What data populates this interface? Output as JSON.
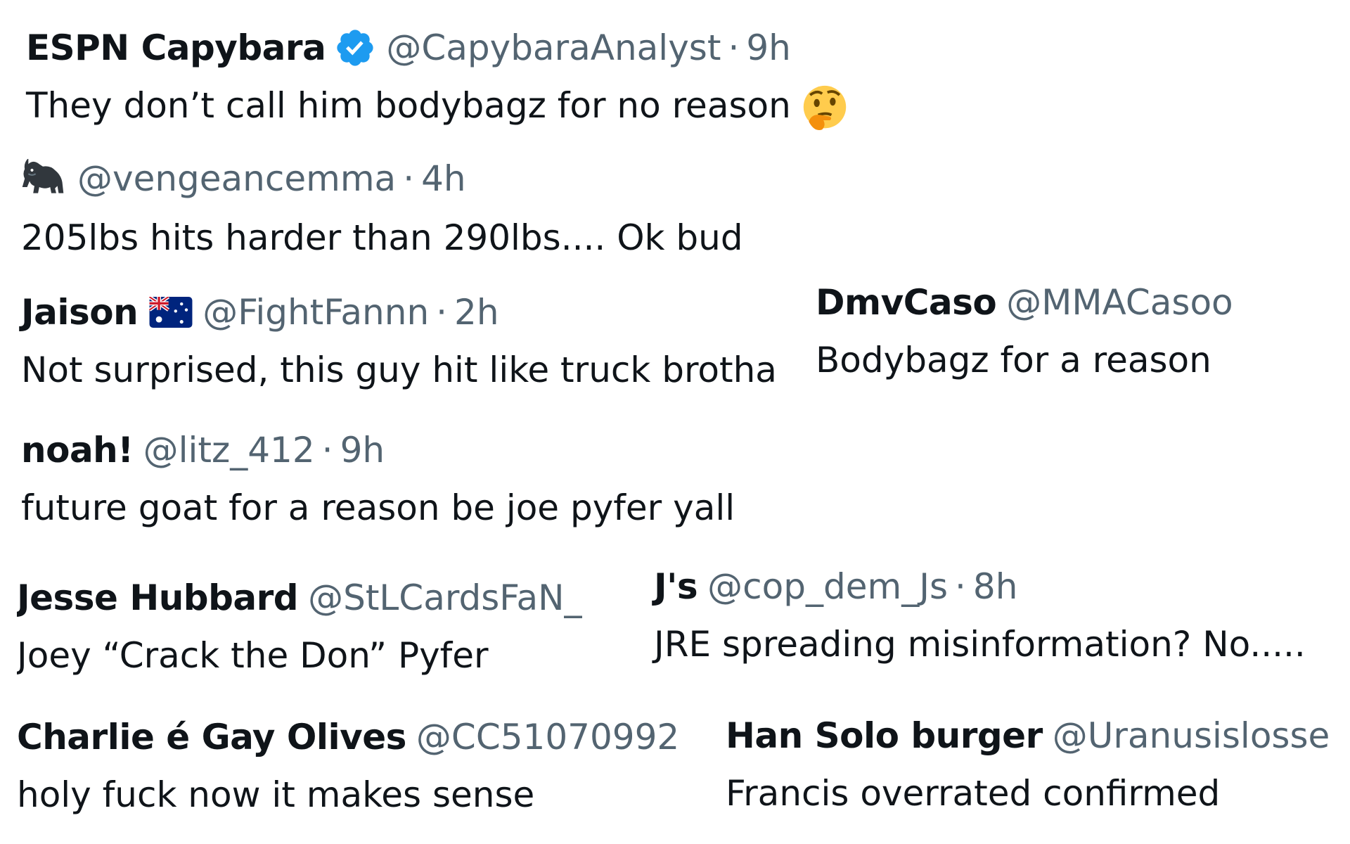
{
  "tweets": [
    {
      "name": "ESPN Capybara",
      "handle": "@CapybaraAnalyst",
      "sep": "·",
      "time": "9h",
      "text": "They don’t call him bodybagz for no reason",
      "text_emoji": "thinking-face-icon",
      "badge": "verified-badge-icon"
    },
    {
      "name_icon": "gorilla-icon",
      "handle": "@vengeancemma",
      "sep": "·",
      "time": "4h",
      "text": "205lbs hits harder than 290lbs.... Ok bud"
    },
    {
      "name": "Jaison",
      "flag": "australia-flag-icon",
      "handle": "@FightFannn",
      "sep": "·",
      "time": "2h",
      "text": "Not surprised, this guy hit like truck brotha"
    },
    {
      "name": "DmvCaso",
      "handle": "@MMACasoo",
      "text": "Bodybagz for a reason"
    },
    {
      "name": "noah!",
      "handle": "@litz_412",
      "sep": "·",
      "time": "9h",
      "text": "future goat for a reason be joe pyfer yall"
    },
    {
      "name": "Jesse Hubbard",
      "handle": "@StLCardsFaN_",
      "text": "Joey “Crack the Don” Pyfer"
    },
    {
      "name": "J's",
      "handle": "@cop_dem_Js",
      "sep": "·",
      "time": "8h",
      "text": "JRE spreading misinformation? No....."
    },
    {
      "name": "Charlie é Gay Olives",
      "handle": "@CC51070992",
      "text": "holy fuck now it makes sense"
    },
    {
      "name": "Han Solo burger",
      "handle": "@Uranusislosse",
      "text": "Francis overrated confirmed"
    }
  ],
  "colors": {
    "text": "#0f1419",
    "secondary": "#536471",
    "verified": "#1d9bf0"
  }
}
